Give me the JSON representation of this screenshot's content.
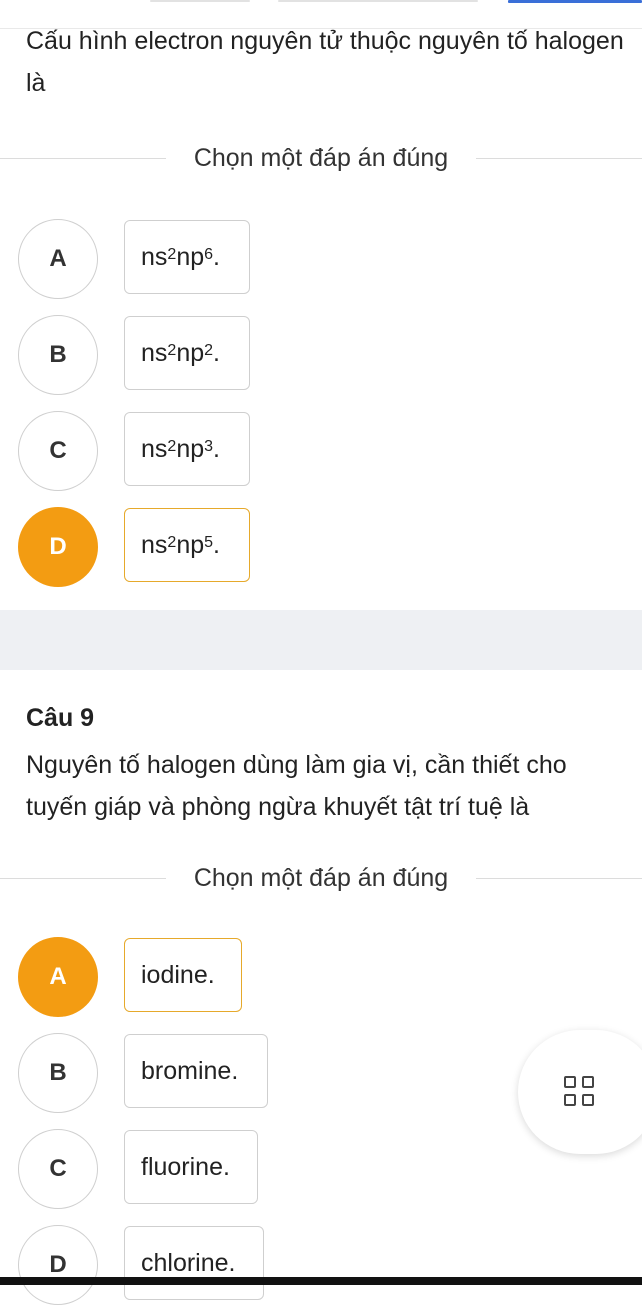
{
  "q8": {
    "text": "Cấu hình electron nguyên tử thuộc nguyên tố halogen là",
    "instruction": "Chọn một đáp án đúng",
    "options": [
      {
        "letter": "A",
        "base": "ns",
        "sup1": "2",
        "mid": "np",
        "sup2": "6",
        "end": ".",
        "selected": false
      },
      {
        "letter": "B",
        "base": "ns",
        "sup1": "2",
        "mid": "np",
        "sup2": "2",
        "end": ".",
        "selected": false
      },
      {
        "letter": "C",
        "base": "ns",
        "sup1": "2",
        "mid": "np",
        "sup2": "3",
        "end": ".",
        "selected": false
      },
      {
        "letter": "D",
        "base": "ns",
        "sup1": "2",
        "mid": "np",
        "sup2": "5",
        "end": ".",
        "selected": true
      }
    ]
  },
  "q9": {
    "number": "Câu 9",
    "text": "Nguyên tố halogen dùng làm gia vị, cần thiết cho tuyến giáp và phòng ngừa khuyết tật trí tuệ là",
    "instruction": "Chọn một đáp án đúng",
    "options": [
      {
        "letter": "A",
        "label": "iodine.",
        "selected": true
      },
      {
        "letter": "B",
        "label": "bromine.",
        "selected": false
      },
      {
        "letter": "C",
        "label": "fluorine.",
        "selected": false
      },
      {
        "letter": "D",
        "label": "chlorine.",
        "selected": false
      }
    ]
  },
  "fab": {
    "icon": "grid-icon"
  },
  "colors": {
    "accent": "#f39c12",
    "tab_active": "#3a6fd8"
  }
}
